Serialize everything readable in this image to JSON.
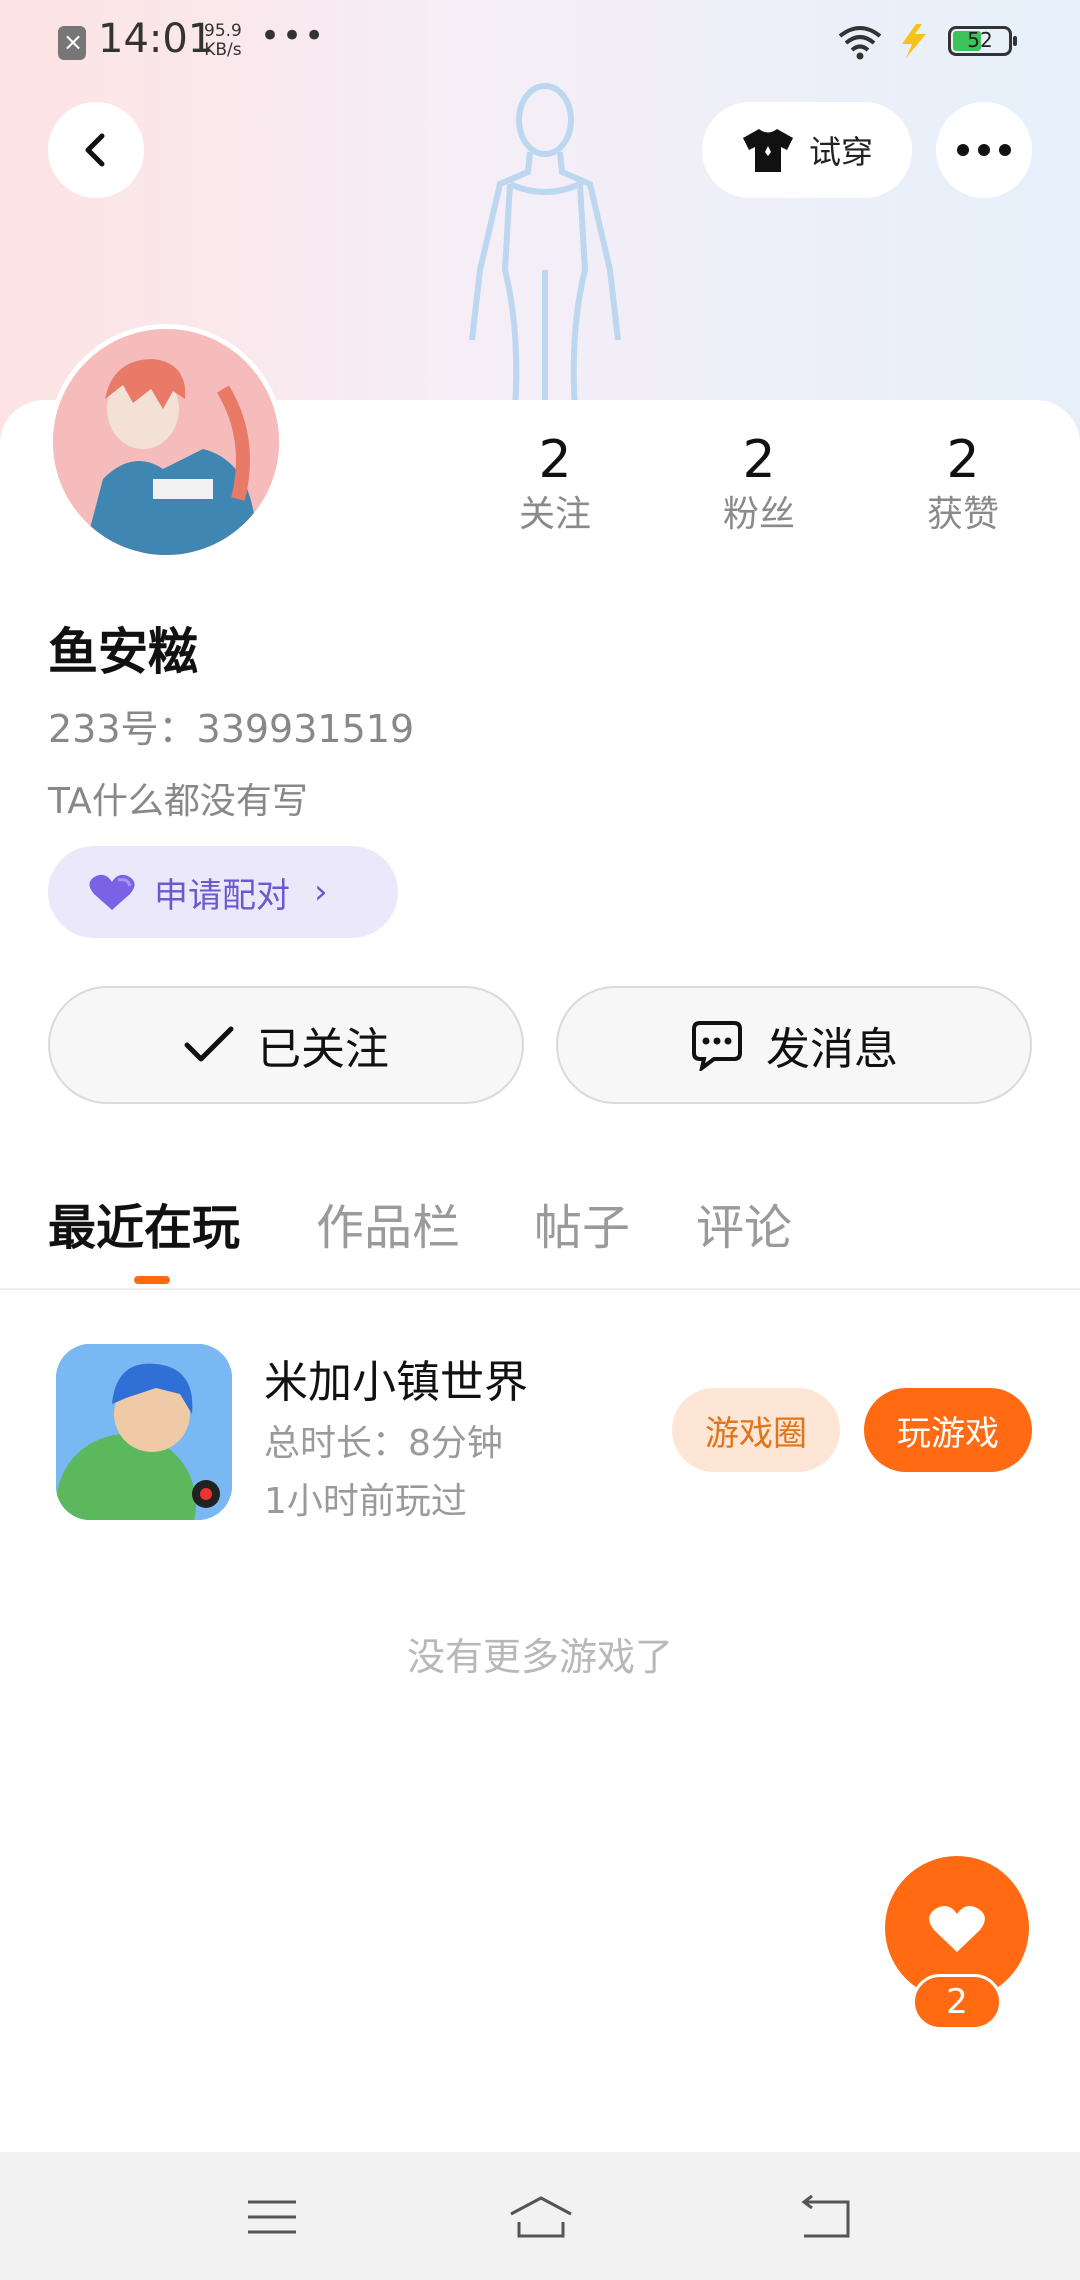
{
  "status_bar": {
    "time": "14:01",
    "net_speed_value": "95.9",
    "net_speed_unit": "KB/s",
    "dots": "•••",
    "battery": "52"
  },
  "header": {
    "tryon_label": "试穿"
  },
  "profile": {
    "name": "鱼安糍",
    "uid": "233号：339931519",
    "bio": "TA什么都没有写",
    "stats": [
      {
        "value": "2",
        "label": "关注"
      },
      {
        "value": "2",
        "label": "粉丝"
      },
      {
        "value": "2",
        "label": "获赞"
      }
    ],
    "pair_label": "申请配对"
  },
  "actions": {
    "follow_label": "已关注",
    "message_label": "发消息"
  },
  "tabs": [
    {
      "label": "最近在玩",
      "active": true
    },
    {
      "label": "作品栏",
      "active": false
    },
    {
      "label": "帖子",
      "active": false
    },
    {
      "label": "评论",
      "active": false
    }
  ],
  "games": [
    {
      "title": "米加小镇世界",
      "duration": "总时长：8分钟",
      "last_played": "1小时前玩过",
      "circle_label": "游戏圈",
      "play_label": "玩游戏"
    }
  ],
  "no_more_text": "没有更多游戏了",
  "like": {
    "count": "2"
  },
  "colors": {
    "accent": "#ff6a13",
    "pair_bg": "#ebe8fb",
    "pair_text": "#6b5acd"
  },
  "icons": [
    "back-icon",
    "tshirt-icon",
    "more-icon",
    "heart-icon",
    "check-icon",
    "chat-icon",
    "menu-icon",
    "home-icon",
    "return-icon",
    "wifi-icon",
    "bolt-icon"
  ]
}
